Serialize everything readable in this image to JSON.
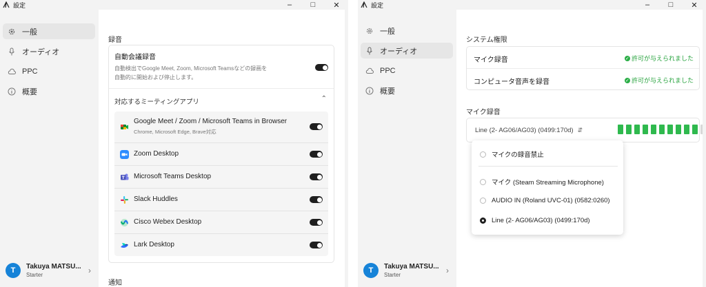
{
  "left_window": {
    "title": "設定",
    "sidebar": [
      {
        "label": "一般",
        "icon": "gear-icon"
      },
      {
        "label": "オーディオ",
        "icon": "microphone-icon"
      },
      {
        "label": "PPC",
        "icon": "cloud-icon"
      },
      {
        "label": "概要",
        "icon": "info-icon"
      }
    ],
    "profile": {
      "avatar_letter": "T",
      "name": "Takuya MATSU...",
      "plan": "Starter"
    },
    "recording_section_title": "録音",
    "auto_record": {
      "title": "自動会議録音",
      "desc_line1": "自動検出でGoogle Meet, Zoom, Microsoft Teamsなどの録画を",
      "desc_line2": "自動的に開始および停止します。",
      "enabled": true
    },
    "apps_header": "対応するミーティングアプリ",
    "apps": [
      {
        "name": "Google Meet / Zoom / Microsoft Teams in Browser",
        "sub": "Chrome, Microsoft Edge, Brave対応",
        "enabled": true
      },
      {
        "name": "Zoom Desktop",
        "enabled": true
      },
      {
        "name": "Microsoft Teams Desktop",
        "enabled": true
      },
      {
        "name": "Slack Huddles",
        "enabled": true
      },
      {
        "name": "Cisco Webex Desktop",
        "enabled": true
      },
      {
        "name": "Lark Desktop",
        "enabled": true
      }
    ],
    "notifications_title": "通知"
  },
  "right_window": {
    "title": "設定",
    "sidebar": [
      {
        "label": "一般",
        "icon": "gear-icon"
      },
      {
        "label": "オーディオ",
        "icon": "microphone-icon"
      },
      {
        "label": "PPC",
        "icon": "cloud-icon"
      },
      {
        "label": "概要",
        "icon": "info-icon"
      }
    ],
    "profile": {
      "avatar_letter": "T",
      "name": "Takuya MATSU...",
      "plan": "Starter"
    },
    "system_permissions_title": "システム権限",
    "permissions": [
      {
        "label": "マイク録音",
        "status": "許可が与えられました"
      },
      {
        "label": "コンピュータ音声を録音",
        "status": "許可が与えられました"
      }
    ],
    "mic_recording_title": "マイク録音",
    "selected_device": "Line (2- AG06/AG03) (0499:170d)",
    "level_meter": {
      "active_segments": 10,
      "total_segments": 11
    },
    "dropdown_options": [
      {
        "label": "マイクの録音禁止",
        "checked": false
      },
      {
        "label": "マイク (Steam Streaming Microphone)",
        "checked": false
      },
      {
        "label": "AUDIO IN (Roland UVC-01) (0582:0260)",
        "checked": false
      },
      {
        "label": "Line (2- AG06/AG03) (0499:170d)",
        "checked": true
      }
    ]
  },
  "colors": {
    "accent_green": "#2fb94e",
    "avatar_blue": "#1683d8",
    "toggle_on": "#1f1f1f"
  }
}
